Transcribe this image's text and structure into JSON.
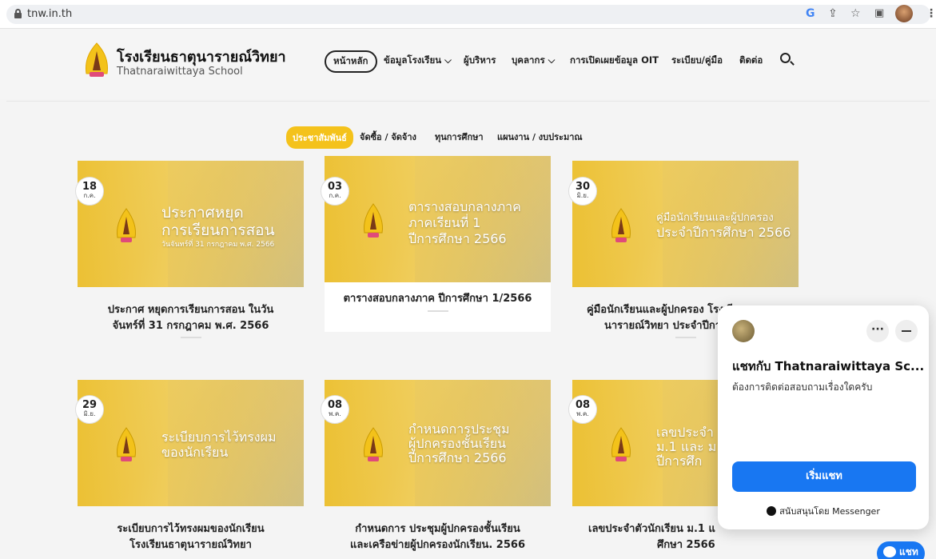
{
  "browser": {
    "url": "tnw.in.th",
    "icons": [
      "google-icon",
      "share-icon",
      "star-icon",
      "sidepanel-icon",
      "profile-avatar",
      "menu-icon"
    ]
  },
  "header": {
    "brand_th": "โรงเรียนธาตุนารายณ์วิทยา",
    "brand_en": "Thatnaraiwittaya School",
    "nav": [
      {
        "label": "หน้าหลัก"
      },
      {
        "label": "ข้อมูลโรงเรียน ⌵"
      },
      {
        "label": "ผู้บริหาร"
      },
      {
        "label": "บุคลากร ⌵"
      },
      {
        "label": "การเปิดเผยข้อมูล OIT"
      },
      {
        "label": "ระเบียบ/คู่มือ"
      },
      {
        "label": "ติดต่อ"
      }
    ]
  },
  "tabs": [
    {
      "label": "ประชาสัมพันธ์"
    },
    {
      "label": "จัดซื้อ / จัดจ้าง"
    },
    {
      "label": "ทุนการศึกษา"
    },
    {
      "label": "แผนงาน / งบประมาณ"
    }
  ],
  "cards": [
    {
      "day": "18",
      "month": "ก.ค.",
      "img_title": [
        "ประกาศหยุด",
        "การเรียนการสอน",
        "วันจันทร์ที่ 31 กรกฎาคม พ.ศ. 2566"
      ],
      "caption": [
        "ประกาศ หยุดการเรียนการสอน ในวัน",
        "จันทร์ที่ 31 กรกฎาคม พ.ศ. 2566"
      ]
    },
    {
      "day": "03",
      "month": "ก.ค.",
      "img_title": [
        "ตารางสอบกลางภาค",
        "ภาคเรียนที่ 1",
        "ปีการศึกษา 2566"
      ],
      "caption": [
        "ตารางสอบกลางภาค ปีการศึกษา 1/2566"
      ]
    },
    {
      "day": "30",
      "month": "มิ.ย.",
      "img_title": [
        "คู่มือนักเรียนและผู้ปกครอง",
        "ประจำปีการศึกษา 2566"
      ],
      "caption": [
        "คู่มือนักเรียนและผู้ปกครอง โรงเรีย",
        "นารายณ์วิทยา ประจำปีการ"
      ]
    },
    {
      "day": "29",
      "month": "มิ.ย.",
      "img_title": [
        "ระเบียบการไว้ทรงผม",
        "ของนักเรียน"
      ],
      "caption": [
        "ระเบียบการไว้ทรงผมของนักเรียน",
        "โรงเรียนธาตุนารายณ์วิทยา"
      ]
    },
    {
      "day": "08",
      "month": "พ.ค.",
      "img_title": [
        "กำหนดการประชุม",
        "ผู้ปกครองชั้นเรียน",
        "ปีการศึกษา 2566"
      ],
      "caption": [
        "กำหนดการ ประชุมผู้ปกครองชั้นเรียน",
        "และเครือข่ายผู้ปกครองนักเรียน. 2566"
      ]
    },
    {
      "day": "08",
      "month": "พ.ค.",
      "img_title": [
        "เลขประจำ",
        "ม.1 และ ม",
        "ปีการศึก"
      ],
      "caption": [
        "เลขประจำตัวนักเรียน ม.1 แ",
        "ศึกษา 2566"
      ]
    }
  ],
  "chat": {
    "title": "แชทกับ Thatnaraiwittaya Sc...",
    "message": "ต้องการติดต่อสอบถามเรื่องใดครับ",
    "start_label": "เริ่มแชท",
    "footer": "สนับสนุนโดย Messenger",
    "more_label": "···",
    "fab_label": "แชท"
  }
}
